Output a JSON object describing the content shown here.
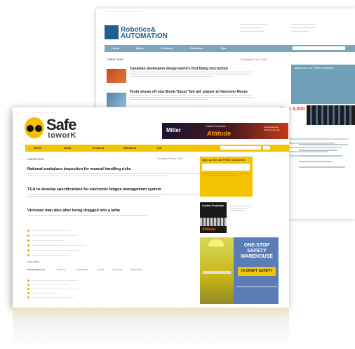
{
  "back_page": {
    "logo": {
      "name_line1": "Robotics&",
      "name_line2": "AUTOMATION"
    },
    "nav": [
      "Home",
      "News",
      "Products",
      "Solutions",
      "Tips"
    ],
    "latest_heading": "Latest news",
    "date": "Thursday 25 June, 2009",
    "stories": [
      {
        "title": "Canadian developers design world's first flying microrobot"
      },
      {
        "title": "Festo shows off new BionicTripod 'fish tail' gripper at Hannover Messe"
      }
    ],
    "signup_heading": "Sign up for our FREE newsletter",
    "promo": "Over 2,000"
  },
  "front_page": {
    "logo": {
      "word1": "Safe",
      "word2": "toworK"
    },
    "banner": {
      "brand": "Miller",
      "tagline": "Custom Protection",
      "big": "Attitude",
      "side": "Auto-Darkening Welding Helmets"
    },
    "nav": [
      "Home",
      "News",
      "Products",
      "Solutions",
      "Tips"
    ],
    "latest_heading": "Latest news",
    "date": "Thursday 25 June, 2009",
    "stories": [
      {
        "title": "National workplace inspection for manual handling risks"
      },
      {
        "title": "TGA to develop specifications for electronic fatigue management system"
      },
      {
        "title": "Victorian man dies after being dragged into a lathe"
      }
    ],
    "more_label": "View more...",
    "tabs": [
      "Add Ons/Sources",
      "Conditions",
      "ChemSafety",
      "Events",
      "Case study",
      "Safety News"
    ],
    "signup_heading": "Sign up for our FREE newsletter",
    "ad1": {
      "top": "Custom Protection",
      "brand": "Attitude"
    },
    "ad2": {
      "headline": "ONE-STOP SAFETY WAREHOUSE",
      "brand": "HI-CRAFT SAFETY"
    }
  }
}
